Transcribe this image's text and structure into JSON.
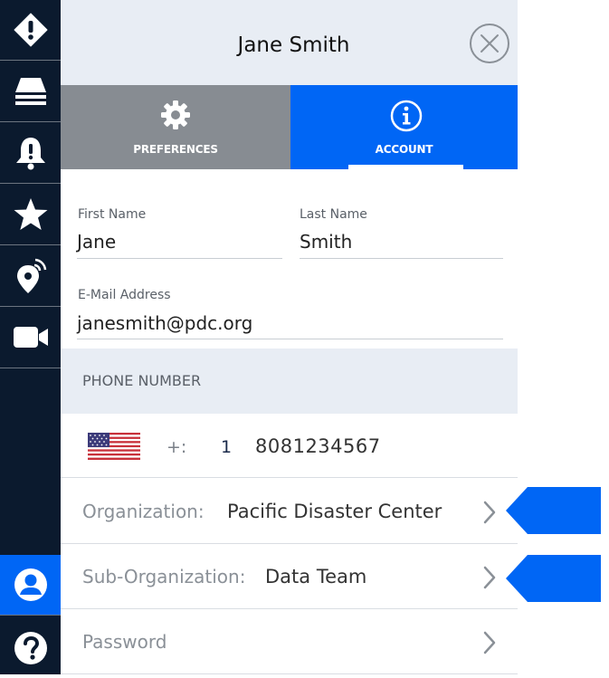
{
  "header": {
    "title": "Jane Smith"
  },
  "tabs": [
    {
      "label": "PREFERENCES",
      "icon": "gear-icon"
    },
    {
      "label": "ACCOUNT",
      "icon": "info-icon"
    }
  ],
  "form": {
    "first_name": {
      "label": "First Name",
      "value": "Jane"
    },
    "last_name": {
      "label": "Last Name",
      "value": "Smith"
    },
    "email": {
      "label": "E-Mail Address",
      "value": "janesmith@pdc.org"
    }
  },
  "phone": {
    "section_label": "PHONE NUMBER",
    "flag": "us-flag-icon",
    "prefix": "+:",
    "country_code": "1",
    "number": "8081234567"
  },
  "rows": [
    {
      "key": "Organization:",
      "value": "Pacific Disaster Center"
    },
    {
      "key": "Sub-Organization:",
      "value": "Data Team"
    },
    {
      "key": "Password",
      "value": ""
    }
  ],
  "sidebar": {
    "items": [
      {
        "icon": "hazard-alert-icon"
      },
      {
        "icon": "layers-icon"
      },
      {
        "icon": "alarm-bell-icon"
      },
      {
        "icon": "star-icon"
      },
      {
        "icon": "location-signal-icon"
      },
      {
        "icon": "video-camera-icon"
      },
      {
        "icon": "user-icon"
      },
      {
        "icon": "help-icon"
      }
    ]
  },
  "colors": {
    "sidebar_bg": "#0b1a2e",
    "accent_blue": "#0066f5",
    "tab_inactive": "#878c92",
    "header_bg": "#e8edf4"
  }
}
